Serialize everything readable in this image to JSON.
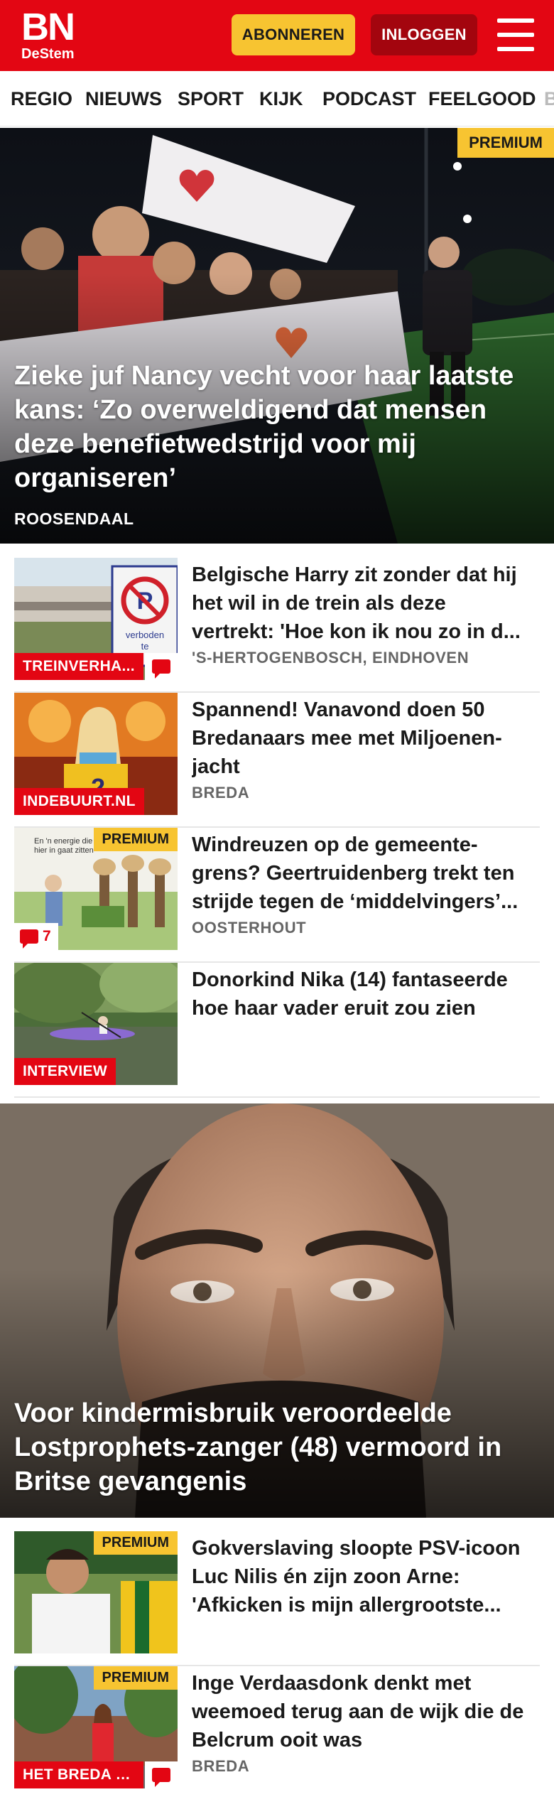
{
  "header": {
    "logo_main": "BN",
    "logo_sub": "DeStem",
    "subscribe_label": "ABONNEREN",
    "login_label": "INLOGGEN"
  },
  "nav": {
    "items": [
      "REGIO",
      "NIEUWS",
      "SPORT",
      "KIJK",
      "PODCAST",
      "FEELGOOD",
      "B"
    ]
  },
  "hero1": {
    "premium": "PREMIUM",
    "title": "Zieke juf Nancy vecht voor haar laatste kans: ‘Zo overweldigend dat mensen deze benefietwedstrijd voor mij organiseren’",
    "location": "ROOSENDAAL"
  },
  "articles": [
    {
      "tag": "TREINVERHA...",
      "title": "Belgische Harry zit zonder dat hij het wil in de trein als deze vertrekt: 'Hoe kon ik nou zo in d...",
      "location": "'S-HERTOGENBOSCH, EINDHOVEN"
    },
    {
      "tag": "INDEBUURT.NL",
      "title": "Spannend! Vanavond doen 50 Bredanaars mee met Miljoenen­jacht",
      "location": "BREDA"
    },
    {
      "premium": "PREMIUM",
      "comments": "7",
      "thumb_caption_1": "En 'n energie die",
      "thumb_caption_2": "hier in gaat zitten",
      "title": "Windreuzen op de gemeente­grens? Geertruidenberg trekt ten strijde tegen de ‘middelvingers’...",
      "location": "OOSTERHOUT"
    },
    {
      "tag": "INTERVIEW",
      "title": "Donorkind Nika (14) fantaseerde hoe haar vader eruit zou zien"
    }
  ],
  "hero2": {
    "title": "Voor kindermisbruik veroordeelde Lostprophets-zanger (48) vermoord in Britse gevangenis"
  },
  "articles2": [
    {
      "premium": "PREMIUM",
      "title": "Gokverslaving sloopte PSV-icoon Luc Nilis én zijn zoon Arne: 'Afkicken is mijn allergrootste..."
    },
    {
      "premium": "PREMIUM",
      "tag": "HET BREDA V...",
      "title": "Inge Verdaasdonk denkt met weemoed terug aan de wijk die de Belcrum ooit was",
      "location": "BREDA"
    }
  ],
  "thumb_sign_text_1": "verboden",
  "thumb_sign_text_2": "te",
  "colors": {
    "brand_red": "#e30613",
    "premium_yellow": "#f7c431",
    "login_dark_red": "#a3050e"
  }
}
